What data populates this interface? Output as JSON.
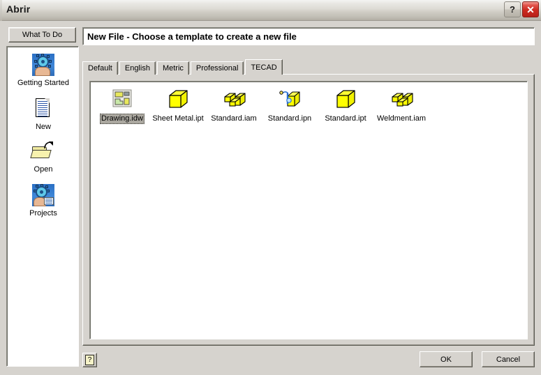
{
  "window": {
    "title": "Abrir",
    "help_button_label": "?",
    "close_button_label": "✕",
    "help_icon_name": "help-question-icon",
    "close_icon_name": "close-x-icon"
  },
  "sidebar": {
    "what_to_do_label": "What To Do",
    "items": [
      {
        "label": "Getting Started",
        "icon": "gear-hand-icon"
      },
      {
        "label": "New",
        "icon": "new-document-icon"
      },
      {
        "label": "Open",
        "icon": "open-folder-icon"
      },
      {
        "label": "Projects",
        "icon": "gear-hand-papers-icon"
      }
    ]
  },
  "main": {
    "header_title": "New File - Choose a template to create a new file",
    "tabs": [
      {
        "label": "Default",
        "active": false
      },
      {
        "label": "English",
        "active": false
      },
      {
        "label": "Metric",
        "active": false
      },
      {
        "label": "Professional",
        "active": false
      },
      {
        "label": "TECAD",
        "active": true
      }
    ],
    "files": [
      {
        "label": "Drawing.idw",
        "icon": "drawing-sheet-icon",
        "selected": true
      },
      {
        "label": "Sheet Metal.ipt",
        "icon": "yellow-cube-icon",
        "selected": false
      },
      {
        "label": "Standard.iam",
        "icon": "yellow-assembly-icon",
        "selected": false
      },
      {
        "label": "Standard.ipn",
        "icon": "presentation-icon",
        "selected": false
      },
      {
        "label": "Standard.ipt",
        "icon": "yellow-cube-icon",
        "selected": false
      },
      {
        "label": "Weldment.iam",
        "icon": "yellow-assembly-icon",
        "selected": false
      }
    ]
  },
  "footer": {
    "help_label": "?",
    "ok_label": "OK",
    "cancel_label": "Cancel"
  },
  "colors": {
    "dialog_face": "#d6d3ce",
    "panel_white": "#ffffff",
    "selection": "#aba8a0",
    "close_red": "#cc2a20",
    "icon_yellow": "#ffff00",
    "icon_blue": "#3f87d8"
  }
}
